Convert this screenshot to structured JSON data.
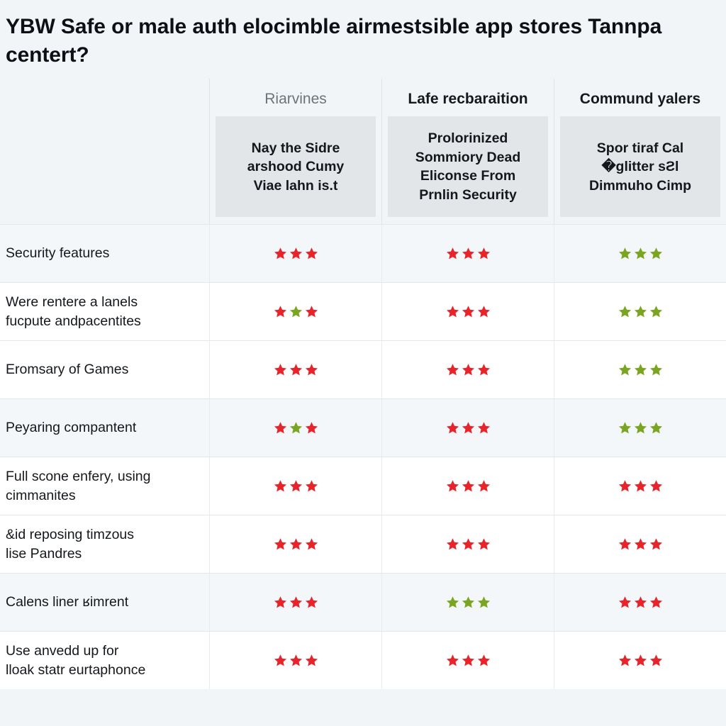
{
  "title": "YBW Safe or male auth elocimble airmestsible app stores Tannpa centert?",
  "colors": {
    "star_red": "#e8232a",
    "star_green": "#7aa520",
    "page_background": "#f2f5f7",
    "header_box_background": "#e3e6e8",
    "row_tint": "#f4f7f9"
  },
  "table": {
    "row_label_header": "",
    "columns": [
      {
        "heading": "Riarvines",
        "subheading": "Nay the Sidre\narshood Cumy\nViae lahn is.t"
      },
      {
        "heading": "Lafe recbaraition",
        "subheading": "Prolorinized\nSommiory Dead\nEliconse From\nPrnlin Security"
      },
      {
        "heading": "Commund yalers",
        "subheading": "Spor tiraf Cal\n�glitter sƧl\nDimmuho Cimp"
      }
    ],
    "rows": [
      {
        "label": "Security features",
        "ratings": [
          [
            "red",
            "red",
            "red"
          ],
          [
            "red",
            "red",
            "red"
          ],
          [
            "green",
            "green",
            "green"
          ]
        ]
      },
      {
        "label": "Were rentere a lanels\nfucpute andpacentites",
        "ratings": [
          [
            "red",
            "green",
            "red"
          ],
          [
            "red",
            "red",
            "red"
          ],
          [
            "green",
            "green",
            "green"
          ]
        ]
      },
      {
        "label": "Eromsary of Games",
        "ratings": [
          [
            "red",
            "red",
            "red"
          ],
          [
            "red",
            "red",
            "red"
          ],
          [
            "green",
            "green",
            "green"
          ]
        ]
      },
      {
        "label": "Peyaring compantent",
        "ratings": [
          [
            "red",
            "green",
            "red"
          ],
          [
            "red",
            "red",
            "red"
          ],
          [
            "green",
            "green",
            "green"
          ]
        ]
      },
      {
        "label": "Full scone enfery, using\ncimmanites",
        "ratings": [
          [
            "red",
            "red",
            "red"
          ],
          [
            "red",
            "red",
            "red"
          ],
          [
            "red",
            "red",
            "red"
          ]
        ]
      },
      {
        "label": "&id reposing timzous\nlise Pandres",
        "ratings": [
          [
            "red",
            "red",
            "red"
          ],
          [
            "red",
            "red",
            "red"
          ],
          [
            "red",
            "red",
            "red"
          ]
        ]
      },
      {
        "label": "Calens liner ʁimrent",
        "ratings": [
          [
            "red",
            "red",
            "red"
          ],
          [
            "green",
            "green",
            "green"
          ],
          [
            "red",
            "red",
            "red"
          ]
        ]
      },
      {
        "label": " Use anvedd up for\nlloak statr eurtaphonce",
        "ratings": [
          [
            "red",
            "red",
            "red"
          ],
          [
            "red",
            "red",
            "red"
          ],
          [
            "red",
            "red",
            "red"
          ]
        ]
      }
    ]
  }
}
